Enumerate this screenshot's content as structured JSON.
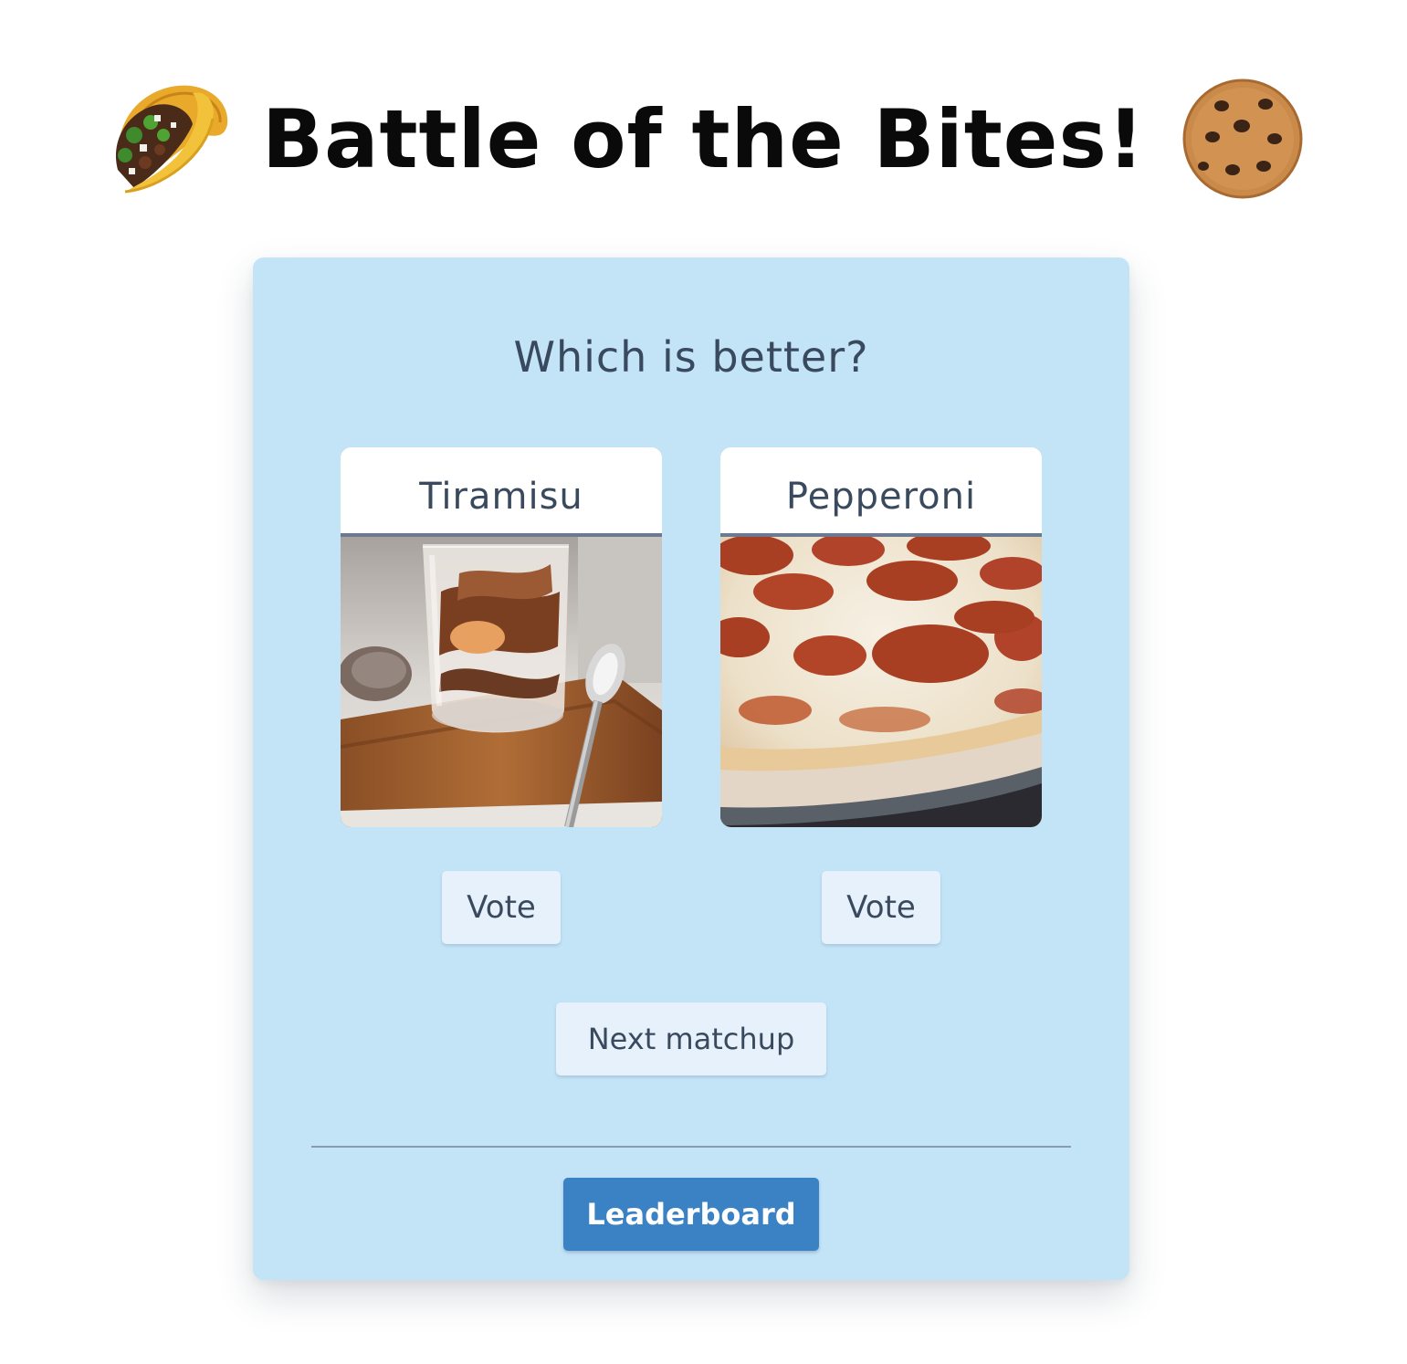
{
  "header": {
    "title": "Battle of the Bites!",
    "left_icon": "taco-icon",
    "right_icon": "cookie-icon"
  },
  "matchup": {
    "question": "Which is better?",
    "options": [
      {
        "name": "Tiramisu",
        "image": "tiramisu-photo",
        "vote_label": "Vote"
      },
      {
        "name": "Pepperoni",
        "image": "pepperoni-pizza-photo",
        "vote_label": "Vote"
      }
    ],
    "next_label": "Next matchup"
  },
  "footer": {
    "leaderboard_label": "Leaderboard"
  },
  "colors": {
    "card_background": "#c3e3f7",
    "button_background": "#e6f1fb",
    "primary_button": "#3b82c4",
    "text": "#3a4a5e",
    "title_text": "#0a0a0a"
  }
}
